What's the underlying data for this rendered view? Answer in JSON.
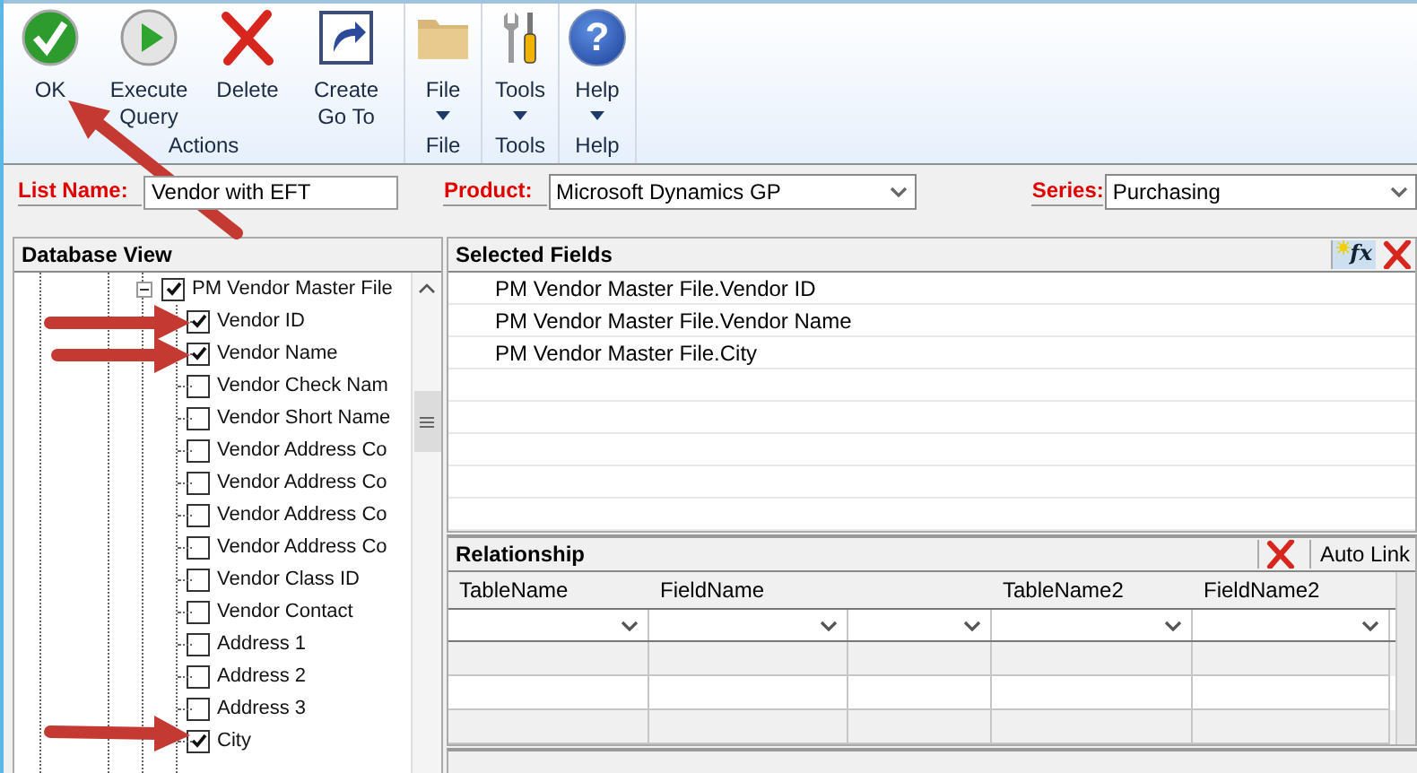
{
  "ribbon": {
    "groups": [
      {
        "label": "Actions",
        "buttons": [
          {
            "label": "OK",
            "kind": "ok",
            "dropdown": false
          },
          {
            "label": "Execute Query",
            "kind": "execute",
            "dropdown": false
          },
          {
            "label": "Delete",
            "kind": "delete",
            "dropdown": false
          },
          {
            "label": "Create Go To",
            "kind": "goto",
            "dropdown": false
          }
        ]
      },
      {
        "label": "File",
        "buttons": [
          {
            "label": "File",
            "kind": "folder",
            "dropdown": true
          }
        ]
      },
      {
        "label": "Tools",
        "buttons": [
          {
            "label": "Tools",
            "kind": "tools",
            "dropdown": true
          }
        ]
      },
      {
        "label": "Help",
        "buttons": [
          {
            "label": "Help",
            "kind": "help",
            "glyph": "?",
            "dropdown": true
          }
        ]
      }
    ]
  },
  "form": {
    "list_name": {
      "label": "List Name:",
      "value": "Vendor with EFT"
    },
    "product": {
      "label": "Product:",
      "value": "Microsoft Dynamics GP"
    },
    "series": {
      "label": "Series:",
      "value": "Purchasing"
    }
  },
  "database_view": {
    "title": "Database View",
    "tree": [
      {
        "label": "PM Vendor Master File",
        "checked": true,
        "expanded": true,
        "children": [
          {
            "label": "Vendor ID",
            "checked": true
          },
          {
            "label": "Vendor Name",
            "checked": true
          },
          {
            "label": "Vendor Check Nam",
            "checked": false
          },
          {
            "label": "Vendor Short Name",
            "checked": false
          },
          {
            "label": "Vendor Address Co",
            "checked": false
          },
          {
            "label": "Vendor Address Co",
            "checked": false
          },
          {
            "label": "Vendor Address Co",
            "checked": false
          },
          {
            "label": "Vendor Address Co",
            "checked": false
          },
          {
            "label": "Vendor Class ID",
            "checked": false
          },
          {
            "label": "Vendor Contact",
            "checked": false
          },
          {
            "label": "Address 1",
            "checked": false
          },
          {
            "label": "Address 2",
            "checked": false
          },
          {
            "label": "Address 3",
            "checked": false
          },
          {
            "label": "City",
            "checked": true
          }
        ]
      }
    ]
  },
  "selected_fields": {
    "title": "Selected Fields",
    "formula_glyph": "fx",
    "items": [
      "PM Vendor Master File.Vendor ID",
      "PM Vendor Master File.Vendor Name",
      "PM Vendor Master File.City"
    ]
  },
  "relationship": {
    "title": "Relationship",
    "auto_link": "Auto Link",
    "columns": [
      {
        "label": "TableName"
      },
      {
        "label": "FieldName"
      },
      {},
      {
        "label": "TableName2"
      },
      {
        "label": "FieldName2"
      }
    ]
  }
}
